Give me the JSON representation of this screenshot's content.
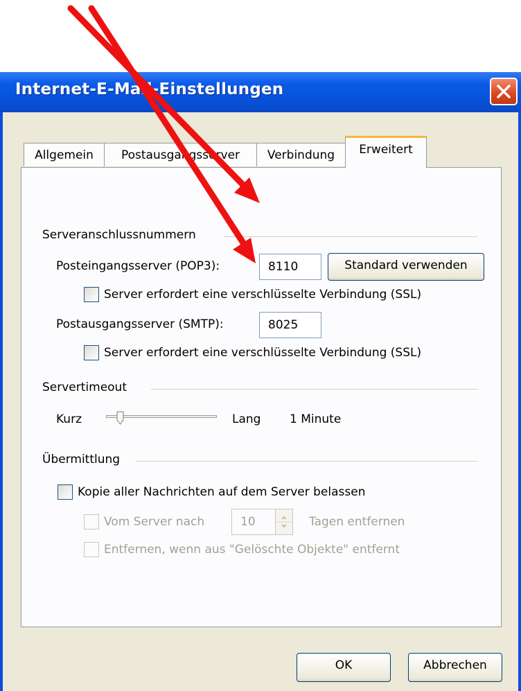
{
  "window": {
    "title": "Internet-E-Mail-Einstellungen"
  },
  "tabs": [
    {
      "label": "Allgemein",
      "active": false
    },
    {
      "label": "Postausgangsserver",
      "active": false
    },
    {
      "label": "Verbindung",
      "active": false
    },
    {
      "label": "Erweitert",
      "active": true
    }
  ],
  "server_ports": {
    "heading": "Serveranschlussnummern",
    "incoming_label": "Posteingangsserver (POP3):",
    "incoming_value": "8110",
    "default_button": "Standard verwenden",
    "incoming_ssl_label": "Server erfordert eine verschlüsselte Verbindung (SSL)",
    "outgoing_label": "Postausgangsserver (SMTP):",
    "outgoing_value": "8025",
    "outgoing_ssl_label": "Server erfordert eine verschlüsselte Verbindung (SSL)"
  },
  "timeout": {
    "heading": "Servertimeout",
    "short_label": "Kurz",
    "long_label": "Lang",
    "value_text": "1 Minute",
    "slider_fraction": 0.1
  },
  "delivery": {
    "heading": "Übermittlung",
    "keep_copy_label": "Kopie aller Nachrichten auf dem Server belassen",
    "remove_after_label": "Vom Server nach",
    "remove_days_value": "10",
    "remove_days_suffix": "Tagen entfernen",
    "remove_deleted_label": "Entfernen, wenn aus \"Gelöschte Objekte\" entfernt"
  },
  "buttons": {
    "ok": "OK",
    "cancel": "Abbrechen"
  },
  "colors": {
    "titlebar": "#0a5ae8",
    "dialog_bg": "#ece9d8",
    "annotation_arrow": "#ee1111"
  }
}
